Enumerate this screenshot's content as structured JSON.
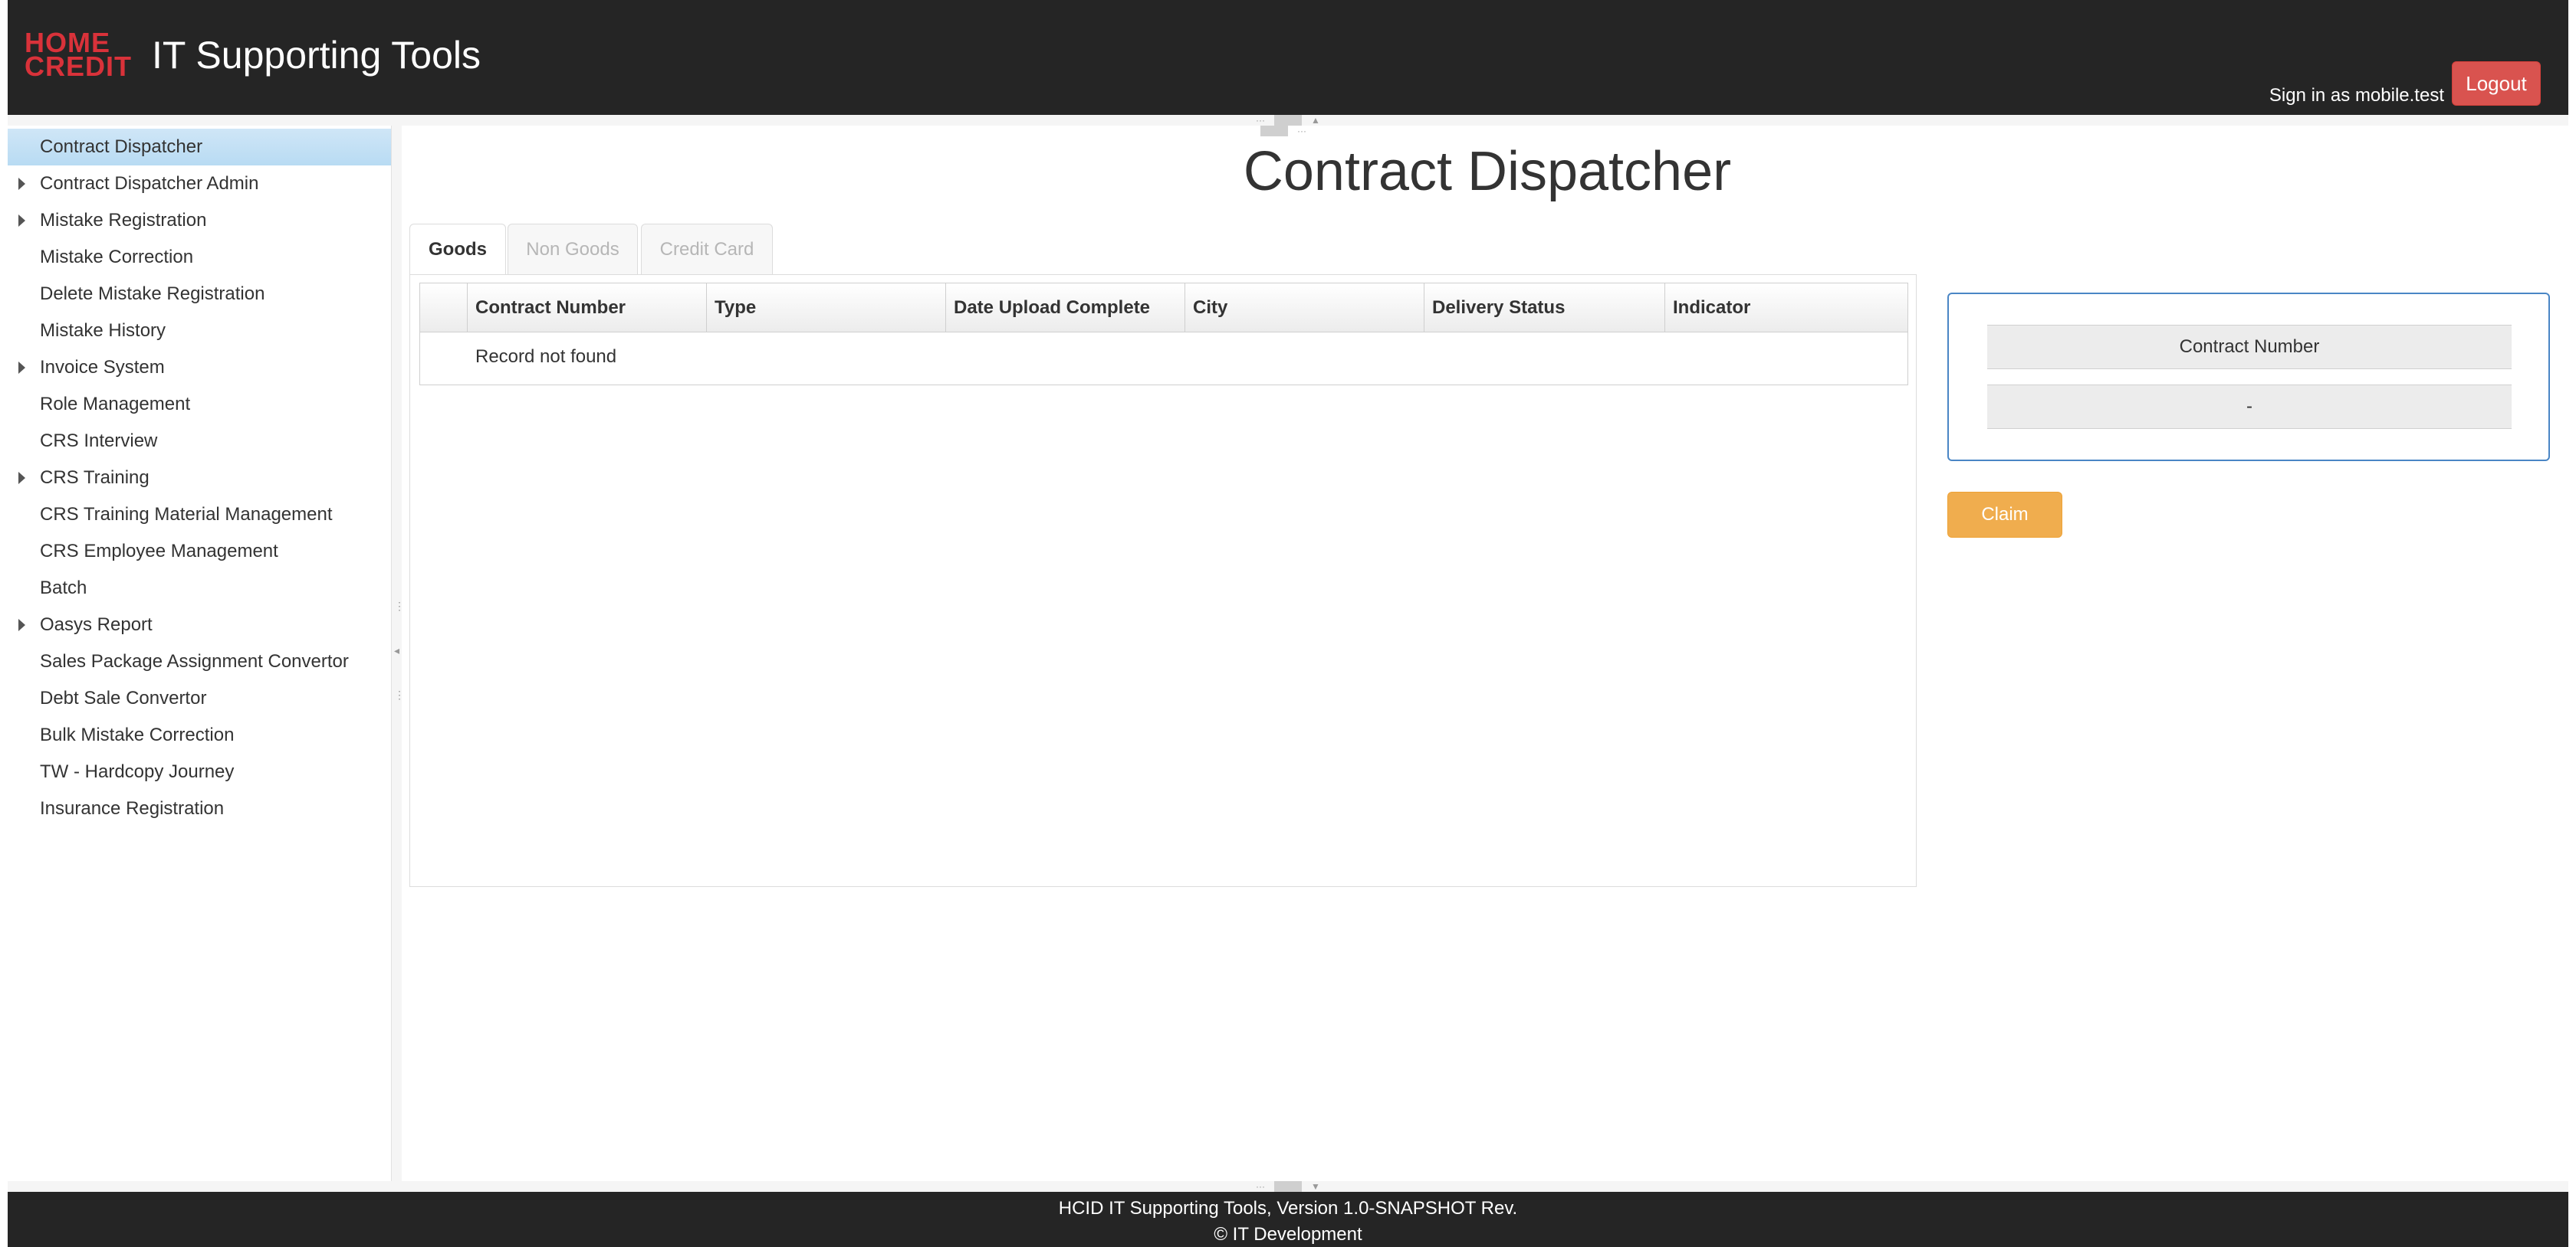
{
  "header": {
    "logo_line1": "HOME",
    "logo_line2": "CREDIT",
    "app_title": "IT Supporting Tools",
    "signin_text": "Sign in as mobile.test",
    "logout_label": "Logout",
    "brand_color": "#d9323a"
  },
  "sidebar": {
    "items": [
      {
        "label": "Contract Dispatcher",
        "expandable": false,
        "active": true
      },
      {
        "label": "Contract Dispatcher Admin",
        "expandable": true
      },
      {
        "label": "Mistake Registration",
        "expandable": true
      },
      {
        "label": "Mistake Correction",
        "expandable": false
      },
      {
        "label": "Delete Mistake Registration",
        "expandable": false
      },
      {
        "label": "Mistake History",
        "expandable": false
      },
      {
        "label": "Invoice System",
        "expandable": true
      },
      {
        "label": "Role Management",
        "expandable": false
      },
      {
        "label": "CRS Interview",
        "expandable": false
      },
      {
        "label": "CRS Training",
        "expandable": true
      },
      {
        "label": "CRS Training Material Management",
        "expandable": false
      },
      {
        "label": "CRS Employee Management",
        "expandable": false
      },
      {
        "label": "Batch",
        "expandable": false
      },
      {
        "label": "Oasys Report",
        "expandable": true
      },
      {
        "label": "Sales Package Assignment Convertor",
        "expandable": false
      },
      {
        "label": "Debt Sale Convertor",
        "expandable": false
      },
      {
        "label": "Bulk Mistake Correction",
        "expandable": false
      },
      {
        "label": "TW - Hardcopy Journey",
        "expandable": false
      },
      {
        "label": "Insurance Registration",
        "expandable": false
      }
    ]
  },
  "main": {
    "title": "Contract Dispatcher",
    "tabs": [
      {
        "label": "Goods",
        "active": true
      },
      {
        "label": "Non Goods",
        "active": false
      },
      {
        "label": "Credit Card",
        "active": false
      }
    ],
    "table": {
      "columns": [
        "Contract Number",
        "Type",
        "Date Upload Complete",
        "City",
        "Delivery Status",
        "Indicator"
      ],
      "empty_message": "Record not found"
    }
  },
  "detail": {
    "header": "Contract Number",
    "value": "-",
    "claim_label": "Claim",
    "claim_color": "#f0ad4e"
  },
  "footer": {
    "line1": "HCID IT Supporting Tools, Version 1.0-SNAPSHOT Rev.",
    "line2": "© IT Development"
  }
}
